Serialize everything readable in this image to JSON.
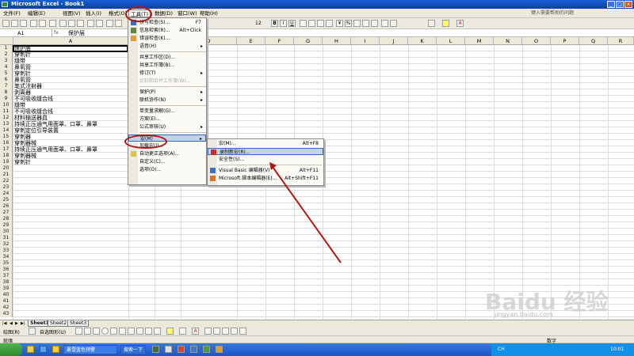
{
  "window": {
    "title": "Microsoft Excel - Book1"
  },
  "menubar": {
    "items": [
      "文件(F)",
      "编辑(E)",
      "视图(V)",
      "插入(I)",
      "格式(O)",
      "工具(T)",
      "数据(D)",
      "窗口(W)",
      "帮助(H)"
    ],
    "help_prompt": "键入需要帮助的问题"
  },
  "toolbar": {
    "font_size": "12"
  },
  "formula_bar": {
    "name_box": "A1",
    "fx": "fx",
    "content": "保护层"
  },
  "columns": [
    "A",
    "B",
    "C",
    "D",
    "E",
    "F",
    "G",
    "H",
    "I",
    "J",
    "K",
    "L",
    "M",
    "N",
    "O",
    "P",
    "Q",
    "R"
  ],
  "rows": {
    "numbers": [
      "1",
      "2",
      "3",
      "4",
      "5",
      "6",
      "7",
      "8",
      "9",
      "10",
      "11",
      "12",
      "13",
      "14",
      "15",
      "16",
      "17",
      "18",
      "19",
      "20",
      "21",
      "22",
      "23",
      "24",
      "25",
      "26",
      "27",
      "28",
      "29",
      "30",
      "31",
      "32",
      "33",
      "34",
      "35",
      "36",
      "37",
      "38",
      "39",
      "40",
      "41",
      "42",
      "43"
    ],
    "col_a": [
      "保护层",
      "穿刺针",
      "缝带",
      "鼻氧管",
      "穿刺针",
      "鼻氧管",
      "笔式注射器",
      "剥离器",
      "不可吸收缝合线",
      "缝带",
      "不可吸收缝合线",
      "材料输送器具",
      "持续正压通气用面罩、口罩、鼻罩",
      "穿刺定位引导装置",
      "穿刺器",
      "穿刺器械",
      "持续正压通气用面罩、口罩、鼻罩",
      "穿刺器械",
      "穿刺针"
    ]
  },
  "tools_menu": {
    "items": [
      {
        "label": "拼写检查(S)...",
        "shortcut": "F7"
      },
      {
        "label": "信息检索(R)...",
        "shortcut": "Alt+Click"
      },
      {
        "label": "错误检查(K)...",
        "shortcut": ""
      },
      {
        "label": "语音(H)",
        "shortcut": ""
      },
      {
        "label": "共享工作区(D)...",
        "shortcut": ""
      },
      {
        "label": "共享工作簿(B)...",
        "shortcut": ""
      },
      {
        "label": "修订(T)",
        "shortcut": ""
      },
      {
        "label": "比较和合并工作簿(W)...",
        "shortcut": ""
      },
      {
        "label": "保护(P)",
        "shortcut": ""
      },
      {
        "label": "联机协作(N)",
        "shortcut": ""
      },
      {
        "label": "单变量求解(G)...",
        "shortcut": ""
      },
      {
        "label": "方案(E)...",
        "shortcut": ""
      },
      {
        "label": "公式审核(U)",
        "shortcut": ""
      },
      {
        "label": "宏(M)",
        "shortcut": ""
      },
      {
        "label": "加载宏(I)...",
        "shortcut": ""
      },
      {
        "label": "自动更正选项(A)...",
        "shortcut": ""
      },
      {
        "label": "自定义(C)...",
        "shortcut": ""
      },
      {
        "label": "选项(O)...",
        "shortcut": ""
      }
    ]
  },
  "macro_submenu": {
    "items": [
      {
        "label": "宏(M)...",
        "shortcut": "Alt+F8"
      },
      {
        "label": "录制新宏(R)...",
        "shortcut": ""
      },
      {
        "label": "安全性(S)...",
        "shortcut": ""
      },
      {
        "label": "Visual Basic 编辑器(V)",
        "shortcut": "Alt+F11"
      },
      {
        "label": "Microsoft 脚本编辑器(E)...",
        "shortcut": "Alt+Shift+F11"
      }
    ]
  },
  "sheet_tabs": [
    "Sheet1",
    "Sheet2",
    "Sheet3"
  ],
  "drawing_bar": {
    "draw_label": "绘图(R)",
    "autoshapes_label": "自选图形(U)"
  },
  "status_bar": {
    "left": "就绪",
    "right": "数字"
  },
  "taskbar": {
    "tasks": [
      "暴雪蓝色预警",
      "搜索一下"
    ],
    "tray_lang": "CH",
    "clock": "10:01"
  },
  "watermark": {
    "text": "Baidu 经验",
    "sub": "jingyan.baidu.com"
  },
  "colors": {
    "title_bar": "#0a3fa6",
    "highlight": "#c1d2ee",
    "annotation": "#b01818"
  }
}
